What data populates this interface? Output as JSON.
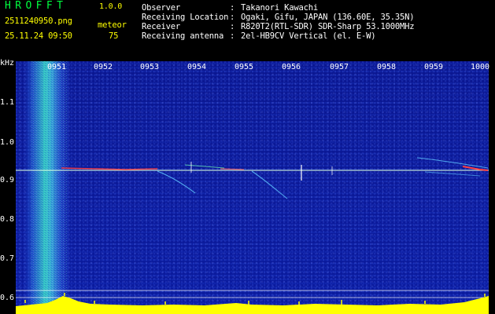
{
  "header": {
    "app_title": "HROFFT",
    "app_version": "1.0.0",
    "filename": "2511240950.png",
    "mode": "meteor",
    "datetime": "25.11.24 09:50",
    "meteor_count": "75"
  },
  "info": {
    "observer_label": "Observer",
    "observer_value": "Takanori Kawachi",
    "location_label": "Receiving Location",
    "location_value": "Ogaki, Gifu, JAPAN (136.60E, 35.35N)",
    "receiver_label": "Receiver",
    "receiver_value": "R820T2(RTL-SDR) SDR-Sharp 53.1000MHz",
    "antenna_label": "Receiving antenna",
    "antenna_value": "2el-HB9CV Vertical (el. E-W)",
    "separator": ":"
  },
  "axis": {
    "unit": "kHz",
    "freq_labels": [
      "1.1",
      "1.0",
      "0.9",
      "0.8",
      "0.7",
      "0.6"
    ],
    "time_labels": [
      "0951",
      "0952",
      "0953",
      "0954",
      "0955",
      "0956",
      "0957",
      "0958",
      "0959",
      "1000"
    ]
  },
  "colors": {
    "background": "#000000",
    "spectrogram": "#0b1999",
    "title_green": "#00ff40",
    "highlight_yellow": "#ffff00",
    "text_white": "#ffffff"
  }
}
